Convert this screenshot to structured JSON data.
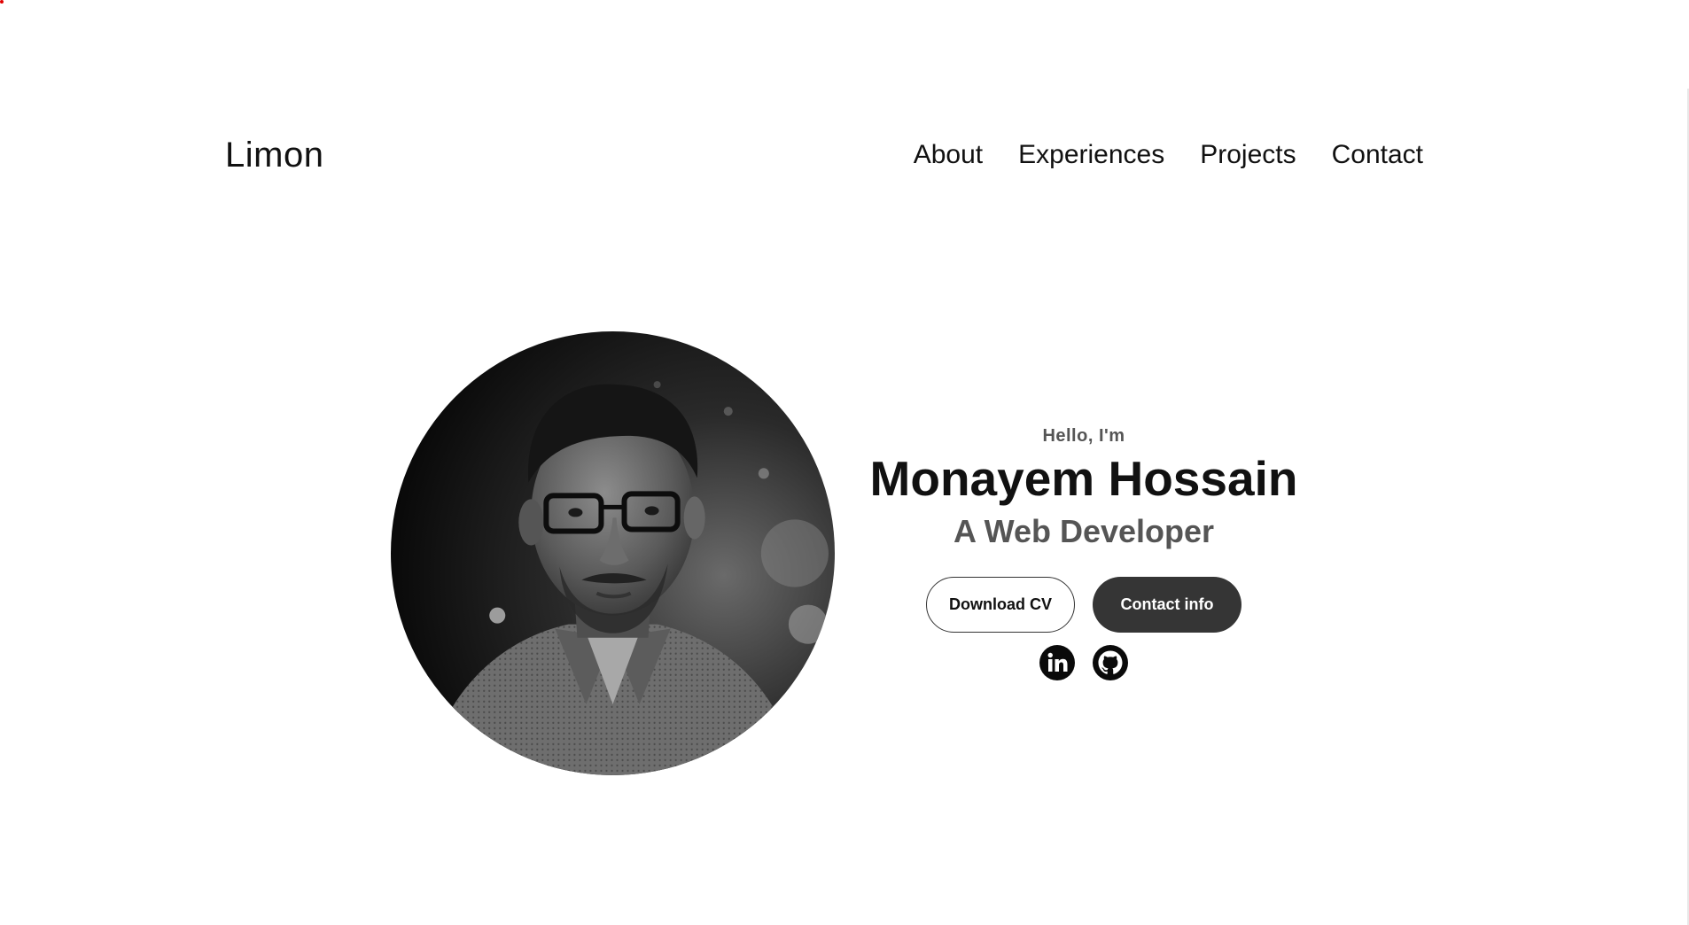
{
  "nav": {
    "logo": "Limon",
    "links": [
      {
        "label": "About"
      },
      {
        "label": "Experiences"
      },
      {
        "label": "Projects"
      },
      {
        "label": "Contact"
      }
    ]
  },
  "hero": {
    "greeting": "Hello, I'm",
    "name": "Monayem Hossain",
    "role": "A Web Developer",
    "buttons": {
      "download_cv": "Download CV",
      "contact_info": "Contact info"
    },
    "socials": [
      {
        "icon": "linkedin-icon"
      },
      {
        "icon": "github-icon"
      }
    ],
    "photo": {
      "icon": "profile-photo",
      "tone": "grayscale"
    }
  },
  "colors": {
    "text": "#111111",
    "muted": "#555555",
    "solid_button": "#353535",
    "background": "#ffffff"
  }
}
